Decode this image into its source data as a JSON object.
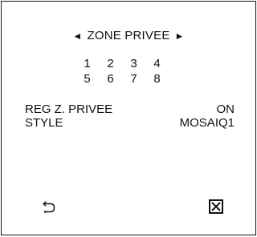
{
  "header": {
    "prev_arrow": "◄",
    "title": "ZONE PRIVEE",
    "next_arrow": "►"
  },
  "zones": [
    "1",
    "2",
    "3",
    "4",
    "5",
    "6",
    "7",
    "8"
  ],
  "settings": [
    {
      "label": "REG Z. PRIVEE",
      "value": "ON"
    },
    {
      "label": "STYLE",
      "value": "MOSAIQ1"
    }
  ],
  "footer": {
    "back_icon": "return-arrow-icon",
    "close_icon": "boxed-x-icon"
  }
}
